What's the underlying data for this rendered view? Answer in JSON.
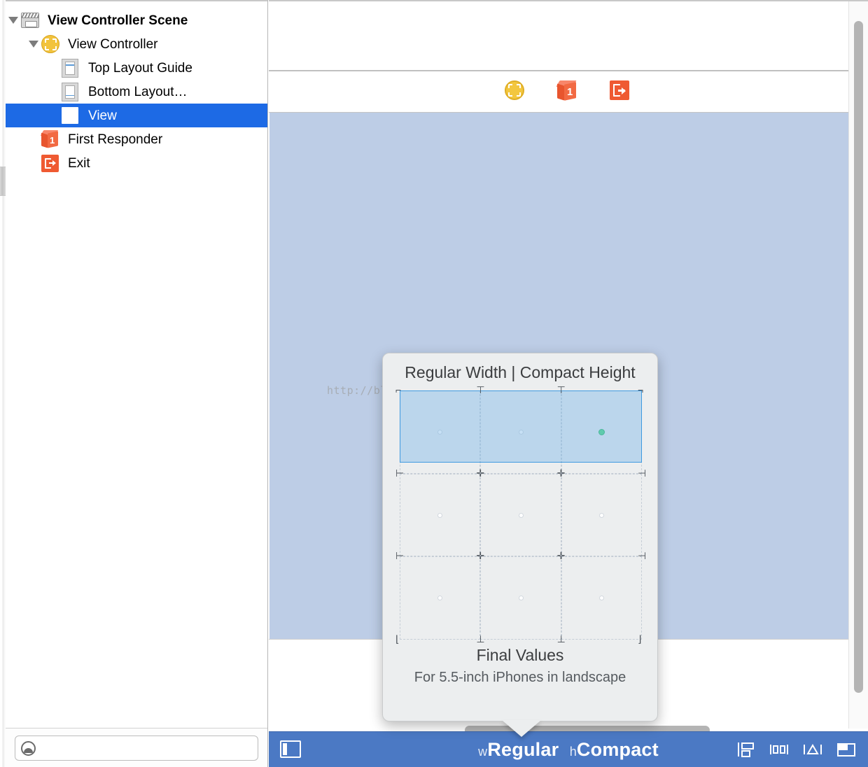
{
  "outline": {
    "items": [
      {
        "label": "View Controller Scene",
        "icon": "scene-icon",
        "indent": 0,
        "disclosure": true,
        "bold": true,
        "selected": false
      },
      {
        "label": "View Controller",
        "icon": "view-controller-icon",
        "indent": 1,
        "disclosure": true,
        "bold": false,
        "selected": false
      },
      {
        "label": "Top Layout Guide",
        "icon": "top-layout-guide-icon",
        "indent": 2,
        "disclosure": false,
        "bold": false,
        "selected": false
      },
      {
        "label": "Bottom Layout…",
        "icon": "bottom-layout-guide-icon",
        "indent": 2,
        "disclosure": false,
        "bold": false,
        "selected": false
      },
      {
        "label": "View",
        "icon": "view-icon",
        "indent": 2,
        "disclosure": false,
        "bold": false,
        "selected": true
      },
      {
        "label": "First Responder",
        "icon": "first-responder-icon",
        "indent": 1,
        "disclosure": false,
        "bold": false,
        "selected": false
      },
      {
        "label": "Exit",
        "icon": "exit-icon",
        "indent": 1,
        "disclosure": false,
        "bold": false,
        "selected": false
      }
    ],
    "filter": {
      "placeholder": "",
      "value": "",
      "icon": "filter-icon"
    }
  },
  "canvas": {
    "watermark": "http://blog.csdn.net/lizhongfu2013",
    "scene_dock": [
      {
        "name": "view-controller-dock-icon",
        "title": "View Controller"
      },
      {
        "name": "first-responder-dock-icon",
        "title": "First Responder",
        "badge": "1"
      },
      {
        "name": "exit-dock-icon",
        "title": "Exit"
      }
    ],
    "view_color": "#bdcde6"
  },
  "popover": {
    "title": "Regular Width | Compact Height",
    "final_values_label": "Final Values",
    "description": "For 5.5-inch iPhones in landscape",
    "selection_color": "#3e9ae0",
    "active_dot_color": "#4edb83",
    "grid": {
      "columns": 3,
      "rows": 3,
      "selected_row": 0,
      "active_cell": [
        0,
        2
      ]
    }
  },
  "statusbar": {
    "background": "#4b79c4",
    "device_config_icon": "size-class-toggle-icon",
    "width_prefix": "w",
    "width_class": "Regular",
    "height_prefix": "h",
    "height_class": "Compact",
    "tools": [
      {
        "name": "stack-button",
        "label": "Stack"
      },
      {
        "name": "align-button",
        "label": "Align"
      },
      {
        "name": "pin-button",
        "label": "Pin"
      },
      {
        "name": "resolve-auto-layout-button",
        "label": "Resolve Auto Layout Issues"
      }
    ]
  }
}
